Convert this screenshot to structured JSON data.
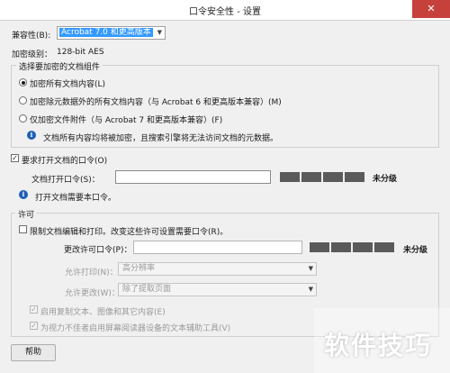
{
  "window": {
    "title": "口令安全性 - 设置",
    "close_glyph": "✕"
  },
  "compat": {
    "label": "兼容性(B):",
    "value": "Acrobat 7.0 和更高版本"
  },
  "encrypt_level": {
    "label": "加密级别：",
    "value": "128-bit AES"
  },
  "components_group": {
    "title": "选择要加密的文档组件",
    "options": [
      "加密所有文档内容(L)",
      "加密除元数据外的所有文档内容（与 Acrobat 6 和更高版本兼容）(M)",
      "仅加密文件附件（与 Acrobat 7 和更高版本兼容）(F)"
    ],
    "selected_index": 0,
    "info_text": "文档所有内容均将被加密，且搜索引擎将无法访问文档的元数据。"
  },
  "open_password": {
    "checkbox_label": "要求打开文档的口令(O)",
    "checked": true,
    "field_label": "文档打开口令(S)：",
    "value": "",
    "strength_label": "未分级",
    "info_text": "打开文档需要本口令。"
  },
  "permissions": {
    "title": "许可",
    "restrict_label": "限制文档编辑和打印。改变这些许可设置需要口令(R)。",
    "restrict_checked": false,
    "change_pw_label": "更改许可口令(P)：",
    "change_pw_value": "",
    "strength_label": "未分级",
    "print_label": "允许打印(N)：",
    "print_value": "高分辨率",
    "changes_label": "允许更改(W)：",
    "changes_value": "除了提取页面",
    "copy_label": "启用复制文本、图像和其它内容(E)",
    "copy_checked": true,
    "screenreader_label": "为视力不佳者启用屏幕阅读器设备的文本辅助工具(V)",
    "screenreader_checked": true
  },
  "help_button": "帮助",
  "watermark": "软件技巧",
  "icons": {
    "info": "info-icon",
    "check": "checkmark-icon",
    "dropdown": "chevron-down-icon",
    "close": "close-icon"
  },
  "colors": {
    "selected_highlight": "#3399ff",
    "info_blue": "#1f5fb6",
    "close_red": "#c7413c",
    "strength_bar": "#5a5a5a"
  }
}
